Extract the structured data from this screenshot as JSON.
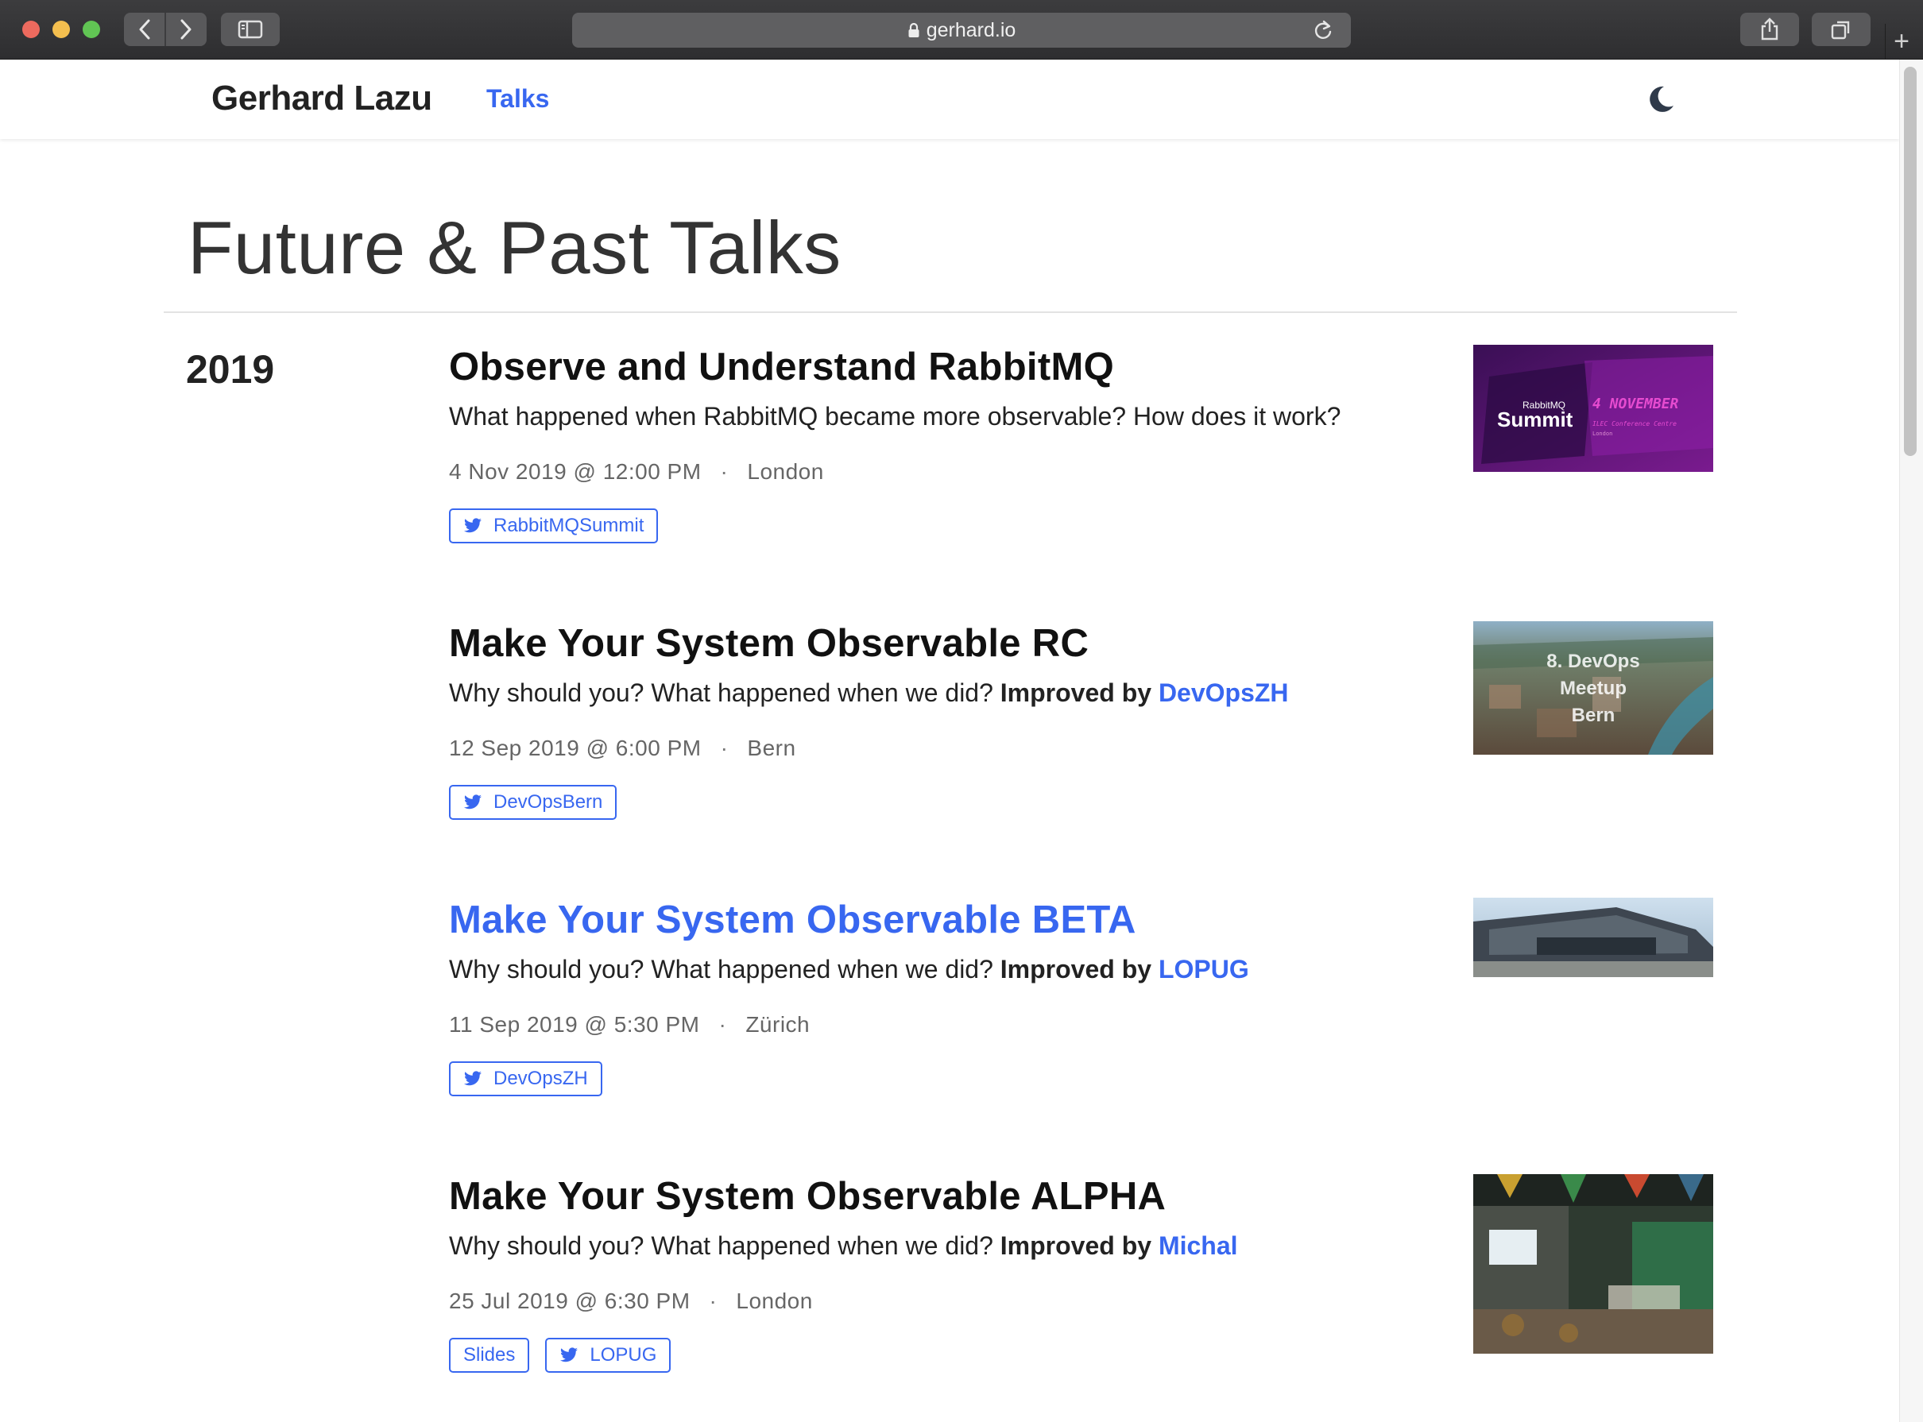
{
  "browser": {
    "url": "gerhard.io",
    "icons": [
      "back-icon",
      "forward-icon",
      "sidebar-icon",
      "lock-icon",
      "reload-icon",
      "share-icon",
      "tabs-icon",
      "plus-icon"
    ]
  },
  "header": {
    "site_title": "Gerhard Lazu",
    "nav_talks": "Talks",
    "theme_icon": "moon-icon"
  },
  "page": {
    "heading": "Future & Past Talks",
    "year": "2019"
  },
  "talks": [
    {
      "title": "Observe and Understand RabbitMQ",
      "description": "What happened when RabbitMQ became more observable? How does it work?",
      "date": "4 Nov 2019 @ 12:00 PM",
      "separator": "·",
      "location": "London",
      "tags": [
        "RabbitMQSummit"
      ],
      "thumbnail": {
        "label_line1": "RabbitMQ",
        "label_line2": "Summit",
        "date_text": "4 NOVEMBER",
        "venue_text": "ILEC Conference Centre",
        "city_text": "London"
      }
    },
    {
      "title": "Make Your System Observable RC",
      "description": "Why should you? What happened when we did?",
      "improved_by_label": "Improved by",
      "improved_by": "DevOpsZH",
      "date": "12 Sep 2019 @ 6:00 PM",
      "separator": "·",
      "location": "Bern",
      "tags": [
        "DevOpsBern"
      ],
      "thumbnail": {
        "line1": "8. DevOps",
        "line2": "Meetup",
        "line3": "Bern"
      }
    },
    {
      "title": "Make Your System Observable BETA",
      "description": "Why should you? What happened when we did?",
      "improved_by_label": "Improved by",
      "improved_by": "LOPUG",
      "date": "11 Sep 2019 @ 5:30 PM",
      "separator": "·",
      "location": "Zürich",
      "tags": [
        "DevOpsZH"
      ]
    },
    {
      "title": "Make Your System Observable ALPHA",
      "description": "Why should you? What happened when we did?",
      "improved_by_label": "Improved by",
      "improved_by": "Michal",
      "date": "25 Jul 2019 @ 6:30 PM",
      "separator": "·",
      "location": "London",
      "slides_label": "Slides",
      "tags": [
        "LOPUG"
      ]
    }
  ],
  "colors": {
    "accent": "#3867f0",
    "text": "#222222",
    "meta": "#666666"
  }
}
